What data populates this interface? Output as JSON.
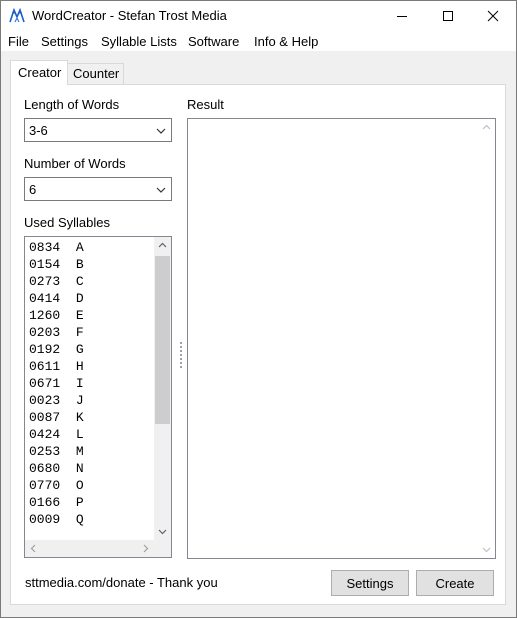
{
  "window": {
    "title": "WordCreator - Stefan Trost Media",
    "icon": "wordcreator-app-icon"
  },
  "menu": {
    "items": [
      {
        "label": "File"
      },
      {
        "label": "Settings"
      },
      {
        "label": "Syllable Lists"
      },
      {
        "label": "Software"
      },
      {
        "label": "Info & Help"
      }
    ]
  },
  "tabs": [
    {
      "label": "Creator",
      "active": true
    },
    {
      "label": "Counter",
      "active": false
    }
  ],
  "creator": {
    "length_label": "Length of Words",
    "length_value": "3-6",
    "number_label": "Number of Words",
    "number_value": "6",
    "syllables_label": "Used Syllables",
    "syllables": [
      {
        "count": "0834",
        "syllable": "A"
      },
      {
        "count": "0154",
        "syllable": "B"
      },
      {
        "count": "0273",
        "syllable": "C"
      },
      {
        "count": "0414",
        "syllable": "D"
      },
      {
        "count": "1260",
        "syllable": "E"
      },
      {
        "count": "0203",
        "syllable": "F"
      },
      {
        "count": "0192",
        "syllable": "G"
      },
      {
        "count": "0611",
        "syllable": "H"
      },
      {
        "count": "0671",
        "syllable": "I"
      },
      {
        "count": "0023",
        "syllable": "J"
      },
      {
        "count": "0087",
        "syllable": "K"
      },
      {
        "count": "0424",
        "syllable": "L"
      },
      {
        "count": "0253",
        "syllable": "M"
      },
      {
        "count": "0680",
        "syllable": "N"
      },
      {
        "count": "0770",
        "syllable": "O"
      },
      {
        "count": "0166",
        "syllable": "P"
      },
      {
        "count": "0009",
        "syllable": "Q"
      }
    ],
    "result_label": "Result",
    "result_text": ""
  },
  "footer": {
    "donate_text": "sttmedia.com/donate - Thank you",
    "settings_button": "Settings",
    "create_button": "Create"
  },
  "colors": {
    "client_bg": "#f0f0f0",
    "button_bg": "#e1e1e1",
    "scroll_thumb": "#cdcdcd"
  }
}
